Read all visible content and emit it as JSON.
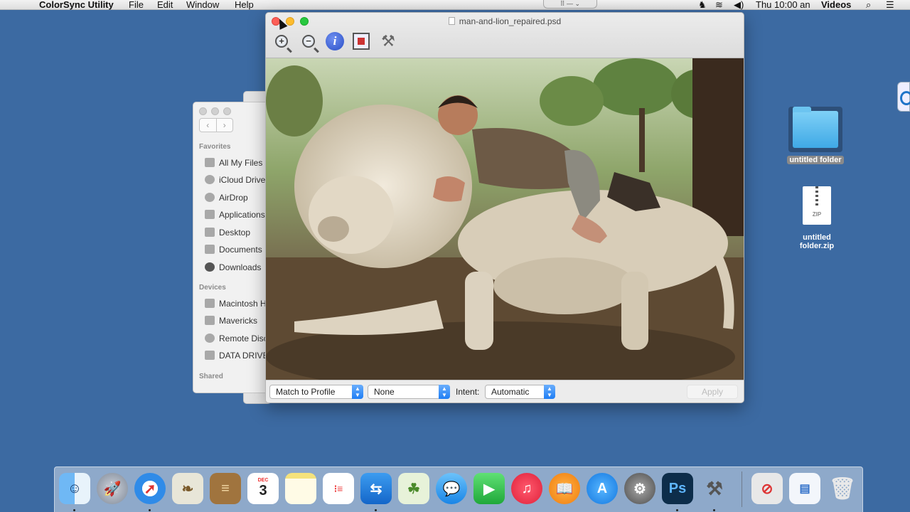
{
  "menubar": {
    "app_name": "ColorSync Utility",
    "menus": [
      "File",
      "Edit",
      "Window",
      "Help"
    ],
    "clock": "Thu 10:00 an",
    "user": "Videos"
  },
  "finder": {
    "favorites_header": "Favorites",
    "favorites": [
      "All My Files",
      "iCloud Drive",
      "AirDrop",
      "Applications",
      "Desktop",
      "Documents",
      "Downloads"
    ],
    "devices_header": "Devices",
    "devices": [
      "Macintosh HD",
      "Mavericks",
      "Remote Disc",
      "DATA DRIVE"
    ],
    "shared_header": "Shared"
  },
  "colorsync": {
    "title": "man-and-lion_repaired.psd",
    "toolbar": [
      "zoom-in-icon",
      "zoom-out-icon",
      "info-icon",
      "crop-icon",
      "tools-icon"
    ],
    "match_popup": "Match to Profile",
    "profile_popup": "None",
    "intent_label": "Intent:",
    "intent_popup": "Automatic",
    "apply_label": "Apply"
  },
  "desktop": {
    "folder_label": "untitled folder",
    "zip_label_line1": "untitled",
    "zip_label_line2": "folder.zip",
    "zip_badge": "ZIP"
  },
  "dock": {
    "apps": [
      "Finder",
      "Launchpad",
      "Safari",
      "Preview",
      "Notefile",
      "Calendar",
      "Notes",
      "Reminders",
      "TeamViewer",
      "Photo Viewer",
      "Messages",
      "FaceTime",
      "iTunes",
      "iBooks",
      "App Store",
      "System Preferences",
      "Photoshop",
      "ColorSync Utility",
      "Disk Utility",
      "Desktop",
      "Trash"
    ],
    "calendar_day": "3",
    "calendar_month": "DEC"
  }
}
